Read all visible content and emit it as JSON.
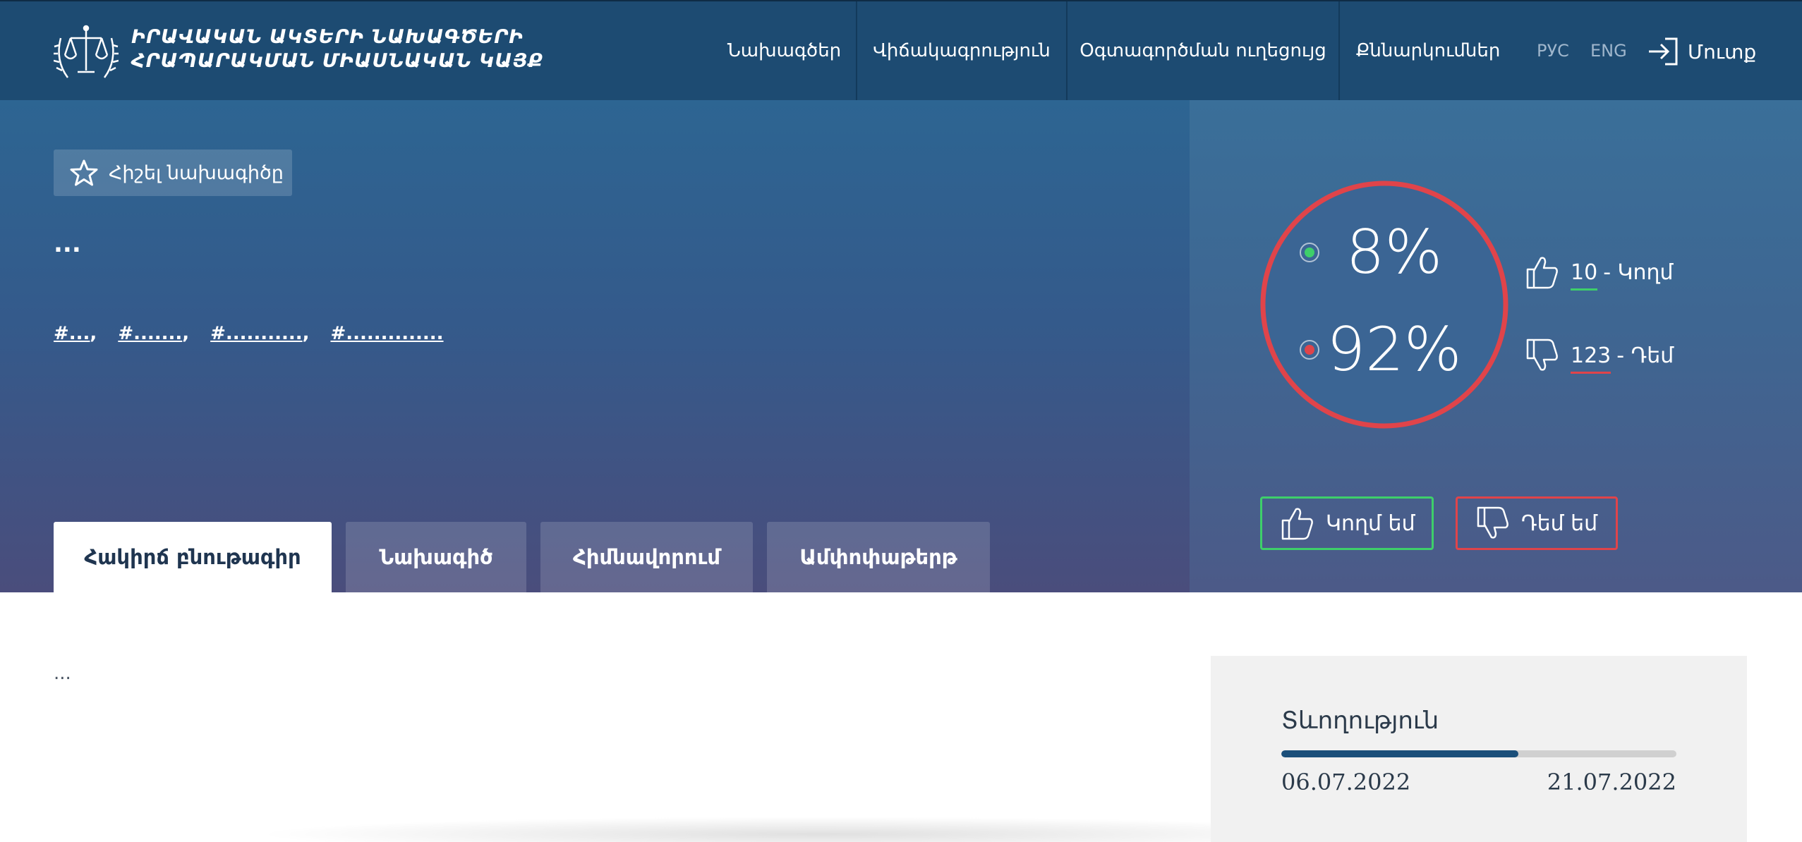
{
  "header": {
    "org_title_line1": "ԻՐԱՎԱԿԱՆ ԱԿՏԵՐԻ ՆԱԽԱԳԾԵՐԻ",
    "org_title_line2": "ՀՐԱՊԱՐԱԿՄԱՆ ՄԻԱՍՆԱԿԱՆ ԿԱՅՔ",
    "nav": [
      {
        "label": "Նախագծեր"
      },
      {
        "label": "Վիճակագրություն"
      },
      {
        "label": "Օգտագործման ուղեցույց"
      },
      {
        "label": "Քննարկումներ"
      }
    ],
    "lang_ru": "РУС",
    "lang_en": "ENG",
    "login_label": "Մուտք"
  },
  "hero": {
    "remember_label": "Հիշել նախագիծը",
    "title": "...",
    "tags": [
      "#...",
      "#.......",
      "#...........",
      "#.............."
    ],
    "tabs": [
      {
        "label": "Հակիրճ բնութագիր",
        "active": true
      },
      {
        "label": "Նախագիծ",
        "active": false
      },
      {
        "label": "Հիմնավորում",
        "active": false
      },
      {
        "label": "Ամփոփաթերթ",
        "active": false
      }
    ]
  },
  "stats": {
    "for_percent": 8,
    "against_percent": 92,
    "for_percent_label": "8%",
    "against_percent_label": "92%",
    "for_count": "10",
    "for_label": "- Կողմ",
    "against_count": "123",
    "against_label": "- Դեմ",
    "vote_for_label": "Կողմ եմ",
    "vote_against_label": "Դեմ եմ",
    "colors": {
      "for": "#3ecf6a",
      "against": "#e0444a"
    }
  },
  "content": {
    "body_text": "..."
  },
  "duration": {
    "title": "Տևողություն",
    "start_date": "06.07.2022",
    "end_date": "21.07.2022",
    "progress": 0.6
  }
}
